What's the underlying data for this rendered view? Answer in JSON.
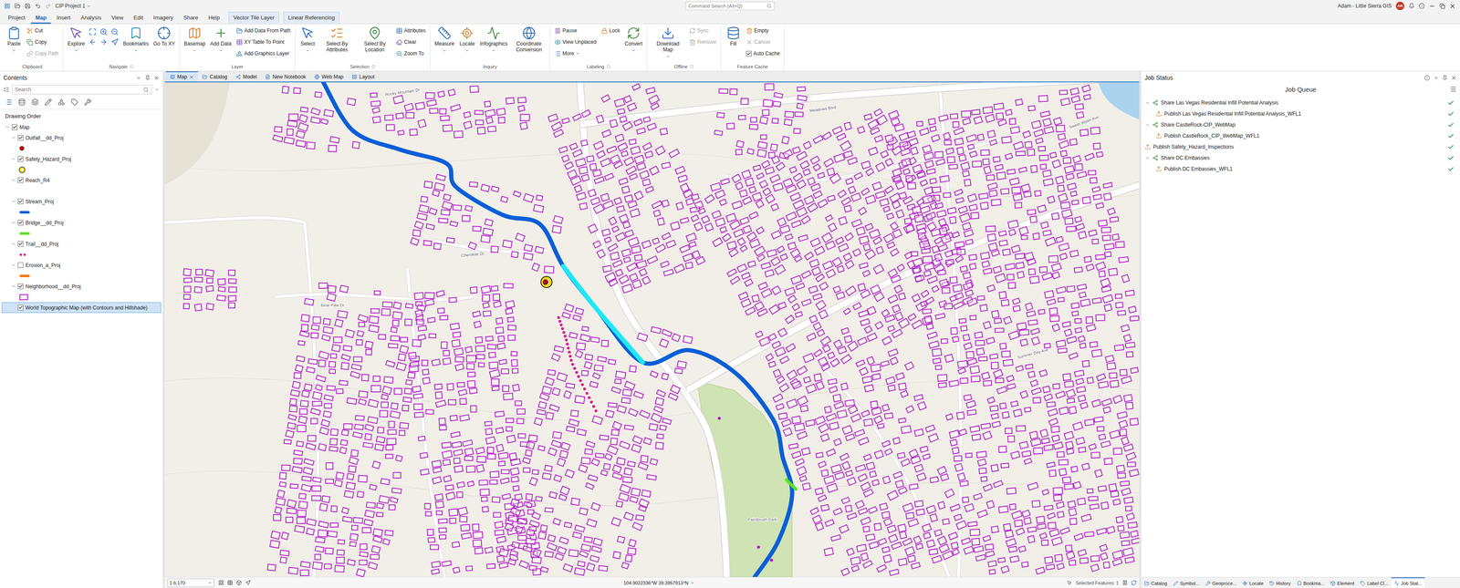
{
  "window": {
    "title": "CIP Project 1",
    "search_placeholder": "Command Search (Alt+Q)",
    "user": "Adam - Little Sierra GIS",
    "avatar": "AR"
  },
  "menu_tabs": [
    {
      "label": "Project",
      "selected": false,
      "contextual": false
    },
    {
      "label": "Map",
      "selected": true,
      "contextual": false
    },
    {
      "label": "Insert",
      "selected": false,
      "contextual": false
    },
    {
      "label": "Analysis",
      "selected": false,
      "contextual": false
    },
    {
      "label": "View",
      "selected": false,
      "contextual": false
    },
    {
      "label": "Edit",
      "selected": false,
      "contextual": false
    },
    {
      "label": "Imagery",
      "selected": false,
      "contextual": false
    },
    {
      "label": "Share",
      "selected": false,
      "contextual": false
    },
    {
      "label": "Help",
      "selected": false,
      "contextual": false
    },
    {
      "label": "Vector Tile Layer",
      "selected": false,
      "contextual": true
    },
    {
      "label": "Linear Referencing",
      "selected": false,
      "contextual": true
    }
  ],
  "ribbon": {
    "groups": [
      {
        "label": "Clipboard",
        "launcher": false,
        "columns": [
          [
            {
              "label": "Paste",
              "kind": "large",
              "dropdown": true,
              "disabled": false
            }
          ],
          [
            {
              "label": "Cut",
              "kind": "small",
              "dropdown": false,
              "disabled": false
            },
            {
              "label": "Copy",
              "kind": "small",
              "dropdown": false,
              "disabled": false
            },
            {
              "label": "Copy Path",
              "kind": "small",
              "dropdown": false,
              "disabled": true
            }
          ]
        ]
      },
      {
        "label": "Navigate",
        "launcher": true,
        "columns": [
          [
            {
              "label": "Explore",
              "kind": "large",
              "dropdown": true,
              "disabled": false
            }
          ],
          [
            {
              "label": "",
              "kind": "tools",
              "dropdown": false,
              "disabled": false
            }
          ],
          [
            {
              "label": "Bookmarks",
              "kind": "large",
              "dropdown": true,
              "disabled": false
            }
          ],
          [
            {
              "label": "Go To XY",
              "kind": "large",
              "dropdown": false,
              "disabled": false
            }
          ]
        ]
      },
      {
        "label": "Layer",
        "launcher": false,
        "columns": [
          [
            {
              "label": "Basemap",
              "kind": "large",
              "dropdown": true,
              "disabled": false
            }
          ],
          [
            {
              "label": "Add Data",
              "kind": "large",
              "dropdown": true,
              "disabled": false
            }
          ],
          [
            {
              "label": "Add Data From Path",
              "kind": "small",
              "dropdown": false,
              "disabled": false
            },
            {
              "label": "XY Table To Point",
              "kind": "small",
              "dropdown": false,
              "disabled": false
            },
            {
              "label": "Add Graphics Layer",
              "kind": "small",
              "dropdown": false,
              "disabled": false
            }
          ]
        ]
      },
      {
        "label": "Selection",
        "launcher": true,
        "columns": [
          [
            {
              "label": "Select",
              "kind": "large",
              "dropdown": true,
              "disabled": false
            }
          ],
          [
            {
              "label": "Select By Attributes",
              "kind": "large",
              "dropdown": false,
              "disabled": false
            }
          ],
          [
            {
              "label": "Select By Location",
              "kind": "large",
              "dropdown": false,
              "disabled": false
            }
          ],
          [
            {
              "label": "Attributes",
              "kind": "small",
              "dropdown": false,
              "disabled": false
            },
            {
              "label": "Clear",
              "kind": "small",
              "dropdown": false,
              "disabled": false
            },
            {
              "label": "Zoom To",
              "kind": "small",
              "dropdown": false,
              "disabled": false
            }
          ]
        ]
      },
      {
        "label": "Inquiry",
        "launcher": false,
        "columns": [
          [
            {
              "label": "Measure",
              "kind": "large",
              "dropdown": true,
              "disabled": false
            }
          ],
          [
            {
              "label": "Locate",
              "kind": "large",
              "dropdown": true,
              "disabled": false
            }
          ],
          [
            {
              "label": "Infographics",
              "kind": "large",
              "dropdown": true,
              "disabled": false
            }
          ],
          [
            {
              "label": "Coordinate Conversion",
              "kind": "large",
              "dropdown": false,
              "disabled": false
            }
          ]
        ]
      },
      {
        "label": "Labeling",
        "launcher": true,
        "columns": [
          [
            {
              "label": "Pause",
              "kind": "small",
              "dropdown": false,
              "disabled": false
            },
            {
              "label": "View Unplaced",
              "kind": "small",
              "dropdown": false,
              "disabled": false
            },
            {
              "label": "More",
              "kind": "small",
              "dropdown": true,
              "disabled": false
            }
          ],
          [
            {
              "label": "Lock",
              "kind": "small",
              "dropdown": false,
              "disabled": false
            }
          ],
          [
            {
              "label": "Convert",
              "kind": "large",
              "dropdown": true,
              "disabled": false
            }
          ]
        ]
      },
      {
        "label": "Offline",
        "launcher": true,
        "columns": [
          [
            {
              "label": "Download Map",
              "kind": "large",
              "dropdown": true,
              "disabled": false
            }
          ],
          [
            {
              "label": "Sync",
              "kind": "small",
              "dropdown": false,
              "disabled": true
            },
            {
              "label": "Remove",
              "kind": "small",
              "dropdown": false,
              "disabled": true
            }
          ]
        ]
      },
      {
        "label": "Feature Cache",
        "launcher": false,
        "columns": [
          [
            {
              "label": "Fill",
              "kind": "large",
              "dropdown": false,
              "disabled": false
            }
          ],
          [
            {
              "label": "Empty",
              "kind": "small",
              "dropdown": false,
              "disabled": false
            },
            {
              "label": "Cancel",
              "kind": "small",
              "dropdown": false,
              "disabled": true
            },
            {
              "label": "Auto Cache",
              "kind": "check",
              "dropdown": false,
              "disabled": false,
              "checked": true
            }
          ]
        ]
      }
    ]
  },
  "contents": {
    "title": "Contents",
    "search_placeholder": "Search",
    "section": "Drawing Order",
    "layers": [
      {
        "name": "Map",
        "kind": "map",
        "checked": true,
        "expandable": true,
        "expanded": true,
        "selected": false,
        "symbol": "none",
        "color": "#000000"
      },
      {
        "name": "Outfall__dd_Proj",
        "kind": "layer",
        "checked": true,
        "expandable": true,
        "expanded": true,
        "selected": false,
        "symbol": "point",
        "color": "#c40000"
      },
      {
        "name": "Safety_Hazard_Proj",
        "kind": "layer",
        "checked": true,
        "expandable": true,
        "expanded": true,
        "selected": false,
        "symbol": "ring",
        "color": "#ffd400"
      },
      {
        "name": "Reach_R4",
        "kind": "layer",
        "checked": true,
        "expandable": true,
        "expanded": true,
        "selected": false,
        "symbol": "none",
        "color": "#000000"
      },
      {
        "name": "Stream_Proj",
        "kind": "layer",
        "checked": true,
        "expandable": true,
        "expanded": true,
        "selected": false,
        "symbol": "line",
        "color": "#0b5ed7"
      },
      {
        "name": "Bridge__dd_Proj",
        "kind": "layer",
        "checked": true,
        "expandable": true,
        "expanded": true,
        "selected": false,
        "symbol": "line",
        "color": "#5fe02a"
      },
      {
        "name": "Trail__dd_Proj",
        "kind": "layer",
        "checked": true,
        "expandable": true,
        "expanded": true,
        "selected": false,
        "symbol": "dots",
        "color": "#e0188c"
      },
      {
        "name": "Erosion_a_Proj",
        "kind": "layer",
        "checked": false,
        "expandable": true,
        "expanded": true,
        "selected": false,
        "symbol": "line",
        "color": "#f07a1a"
      },
      {
        "name": "Neighborhood__dd_Proj",
        "kind": "layer",
        "checked": true,
        "expandable": true,
        "expanded": true,
        "selected": false,
        "symbol": "polygon",
        "color": "#b01cc8"
      },
      {
        "name": "World Topographic Map (with Contours and Hillshade)",
        "kind": "basemap",
        "checked": true,
        "expandable": false,
        "expanded": false,
        "selected": true,
        "symbol": "none",
        "color": "#000000"
      }
    ]
  },
  "map_tabs": [
    {
      "label": "Map",
      "selected": true
    },
    {
      "label": "Catalog",
      "selected": false
    },
    {
      "label": "Model",
      "selected": false
    },
    {
      "label": "New Notebook",
      "selected": false
    },
    {
      "label": "Web Map",
      "selected": false
    },
    {
      "label": "Layout",
      "selected": false
    }
  ],
  "map": {
    "labels": [
      "Rocky Mountain Dr",
      "Meadows Blvd",
      "Cherokee Dr",
      "Bear Paw Dr",
      "Paintbrush Park",
      "Sweet Water Ave",
      "Summer Day Ave"
    ]
  },
  "map_status": {
    "scale": "1:6,170",
    "coordinates": "104.9022336°W 39.3957913°N",
    "selected_features": "Selected Features: 1"
  },
  "job_status": {
    "title": "Job Status",
    "subtitle": "Job Queue",
    "jobs": [
      {
        "label": "Share Las Vegas Residential Infill Potential Analysis",
        "child": false,
        "has_children": true,
        "expanded": true,
        "done": true
      },
      {
        "label": "Publish Las Vegas Residential Infill Potential Analysis_WFL1",
        "child": true,
        "has_children": false,
        "expanded": false,
        "done": true
      },
      {
        "label": "Share CastleRock-CIP_WebMap",
        "child": false,
        "has_children": true,
        "expanded": true,
        "done": true
      },
      {
        "label": "Publish CastleRock_CIP_WebMap_WFL1",
        "child": true,
        "has_children": false,
        "expanded": false,
        "done": true
      },
      {
        "label": "Publish Safety_Hazard_Inspections",
        "child": false,
        "has_children": false,
        "expanded": false,
        "done": true
      },
      {
        "label": "Share DC Embassies",
        "child": false,
        "has_children": true,
        "expanded": true,
        "done": true
      },
      {
        "label": "Publish DC Embassies_WFL1",
        "child": true,
        "has_children": false,
        "expanded": false,
        "done": true
      }
    ]
  },
  "bottom_tabs": [
    {
      "label": "Catalog",
      "selected": false
    },
    {
      "label": "Symbol...",
      "selected": false
    },
    {
      "label": "Geoproce...",
      "selected": false
    },
    {
      "label": "Locate",
      "selected": false
    },
    {
      "label": "History",
      "selected": false
    },
    {
      "label": "Bookma...",
      "selected": false
    },
    {
      "label": "Element",
      "selected": false
    },
    {
      "label": "Label Cl...",
      "selected": false
    },
    {
      "label": "Job Stat...",
      "selected": true
    }
  ]
}
